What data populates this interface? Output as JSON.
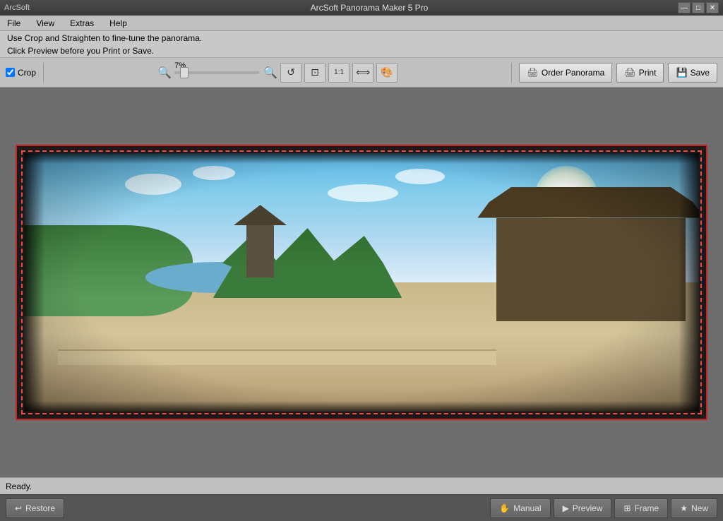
{
  "app": {
    "title": "ArcSoft Panorama Maker 5 Pro",
    "window_controls": {
      "minimize": "—",
      "maximize": "□",
      "close": "✕"
    }
  },
  "menu": {
    "items": [
      "File",
      "View",
      "Extras",
      "Help"
    ]
  },
  "instructions": {
    "line1": "Use Crop and Straighten to fine-tune the panorama.",
    "line2": "Click Preview before you Print or Save."
  },
  "toolbar": {
    "zoom_percent": "7%",
    "crop_label": "Crop",
    "order_btn": "Order Panorama",
    "print_btn": "Print",
    "save_btn": "Save"
  },
  "status": {
    "text": "Ready."
  },
  "bottom_toolbar": {
    "restore_btn": "Restore",
    "manual_btn": "Manual",
    "preview_btn": "Preview",
    "frame_btn": "Frame",
    "new_btn": "New"
  }
}
